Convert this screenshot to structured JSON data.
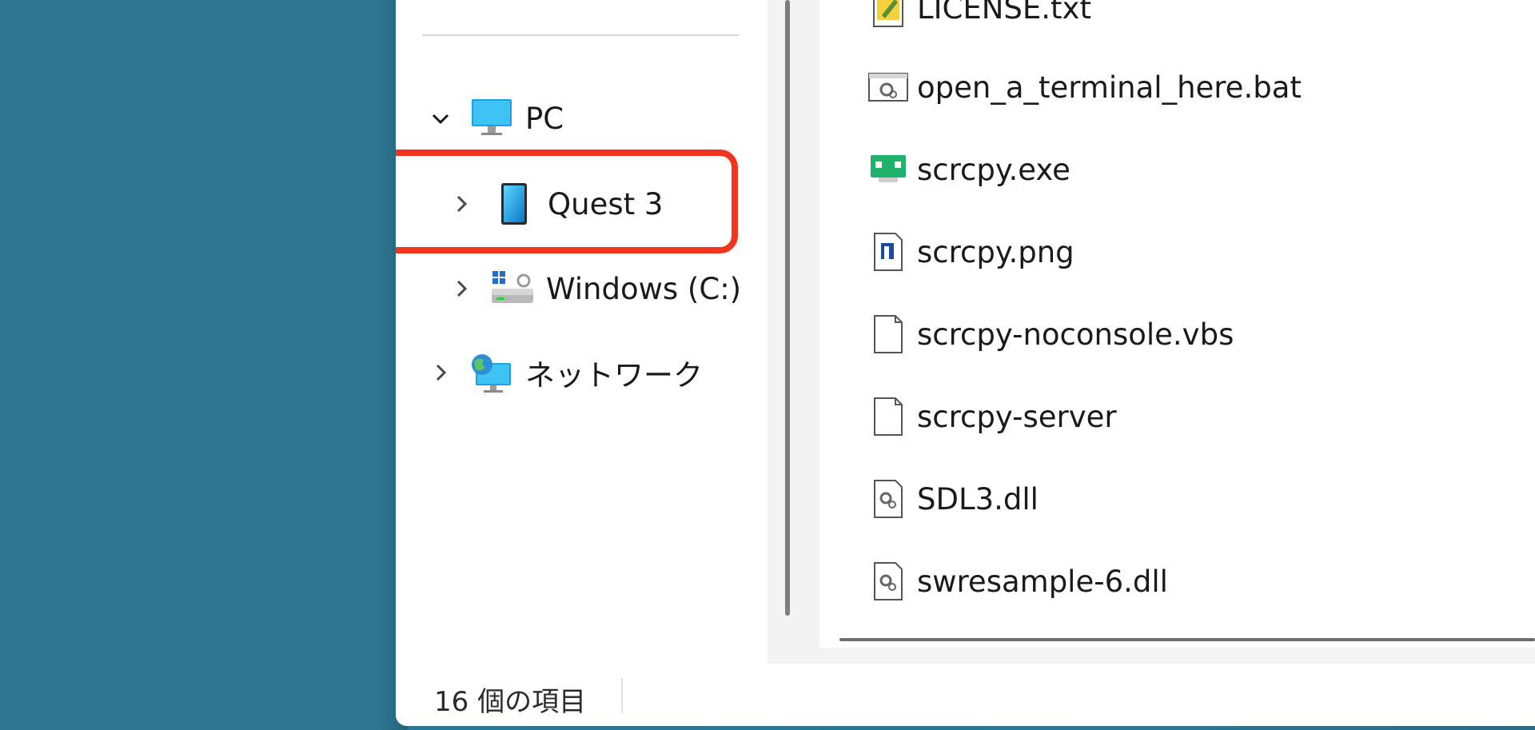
{
  "navigation": {
    "pc": {
      "label": "PC",
      "icon": "monitor-icon",
      "expanded": true
    },
    "quest": {
      "label": "Quest 3",
      "icon": "phone-device-icon",
      "expanded": false
    },
    "windows_drive": {
      "label": "Windows (C:)",
      "icon": "system-drive-icon",
      "expanded": false
    },
    "network": {
      "label": "ネットワーク",
      "icon": "network-globe-icon",
      "expanded": false
    }
  },
  "files": [
    {
      "name": "LICENSE.txt",
      "icon": "text-file-icon"
    },
    {
      "name": "open_a_terminal_here.bat",
      "icon": "batch-file-icon"
    },
    {
      "name": "scrcpy.exe",
      "icon": "exe-app-icon"
    },
    {
      "name": "scrcpy.png",
      "icon": "image-file-icon"
    },
    {
      "name": "scrcpy-noconsole.vbs",
      "icon": "blank-file-icon"
    },
    {
      "name": "scrcpy-server",
      "icon": "blank-file-icon"
    },
    {
      "name": "SDL3.dll",
      "icon": "dll-file-icon"
    },
    {
      "name": "swresample-6.dll",
      "icon": "dll-file-icon"
    }
  ],
  "status": {
    "item_count": "16 個の項目"
  },
  "colors": {
    "highlight": "#f0341d",
    "desktop": "#2e7896"
  }
}
